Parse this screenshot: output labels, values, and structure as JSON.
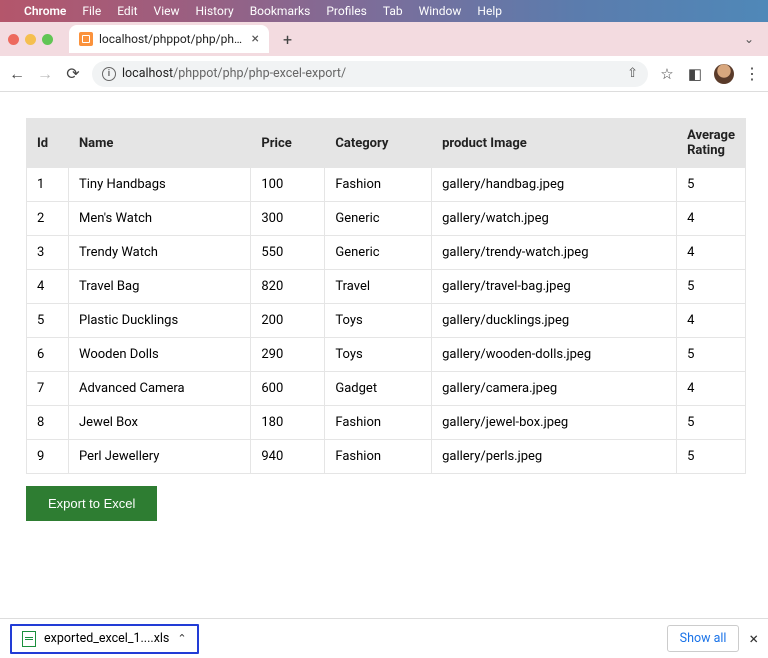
{
  "menubar": {
    "items": [
      "Chrome",
      "File",
      "Edit",
      "View",
      "History",
      "Bookmarks",
      "Profiles",
      "Tab",
      "Window",
      "Help"
    ]
  },
  "tab": {
    "title": "localhost/phppot/php/php-exc"
  },
  "url": {
    "host": "localhost",
    "path": "/phppot/php/php-excel-export/"
  },
  "table": {
    "headers": [
      "Id",
      "Name",
      "Price",
      "Category",
      "product Image",
      "Average Rating"
    ],
    "rows": [
      {
        "id": "1",
        "name": "Tiny Handbags",
        "price": "100",
        "category": "Fashion",
        "image": "gallery/handbag.jpeg",
        "rating": "5"
      },
      {
        "id": "2",
        "name": "Men's Watch",
        "price": "300",
        "category": "Generic",
        "image": "gallery/watch.jpeg",
        "rating": "4"
      },
      {
        "id": "3",
        "name": "Trendy Watch",
        "price": "550",
        "category": "Generic",
        "image": "gallery/trendy-watch.jpeg",
        "rating": "4"
      },
      {
        "id": "4",
        "name": "Travel Bag",
        "price": "820",
        "category": "Travel",
        "image": "gallery/travel-bag.jpeg",
        "rating": "5"
      },
      {
        "id": "5",
        "name": "Plastic Ducklings",
        "price": "200",
        "category": "Toys",
        "image": "gallery/ducklings.jpeg",
        "rating": "4"
      },
      {
        "id": "6",
        "name": "Wooden Dolls",
        "price": "290",
        "category": "Toys",
        "image": "gallery/wooden-dolls.jpeg",
        "rating": "5"
      },
      {
        "id": "7",
        "name": "Advanced Camera",
        "price": "600",
        "category": "Gadget",
        "image": "gallery/camera.jpeg",
        "rating": "4"
      },
      {
        "id": "8",
        "name": "Jewel Box",
        "price": "180",
        "category": "Fashion",
        "image": "gallery/jewel-box.jpeg",
        "rating": "5"
      },
      {
        "id": "9",
        "name": "Perl Jewellery",
        "price": "940",
        "category": "Fashion",
        "image": "gallery/perls.jpeg",
        "rating": "5"
      }
    ]
  },
  "buttons": {
    "export": "Export to Excel"
  },
  "downloads": {
    "item": "exported_excel_1....xls",
    "showall": "Show all"
  }
}
